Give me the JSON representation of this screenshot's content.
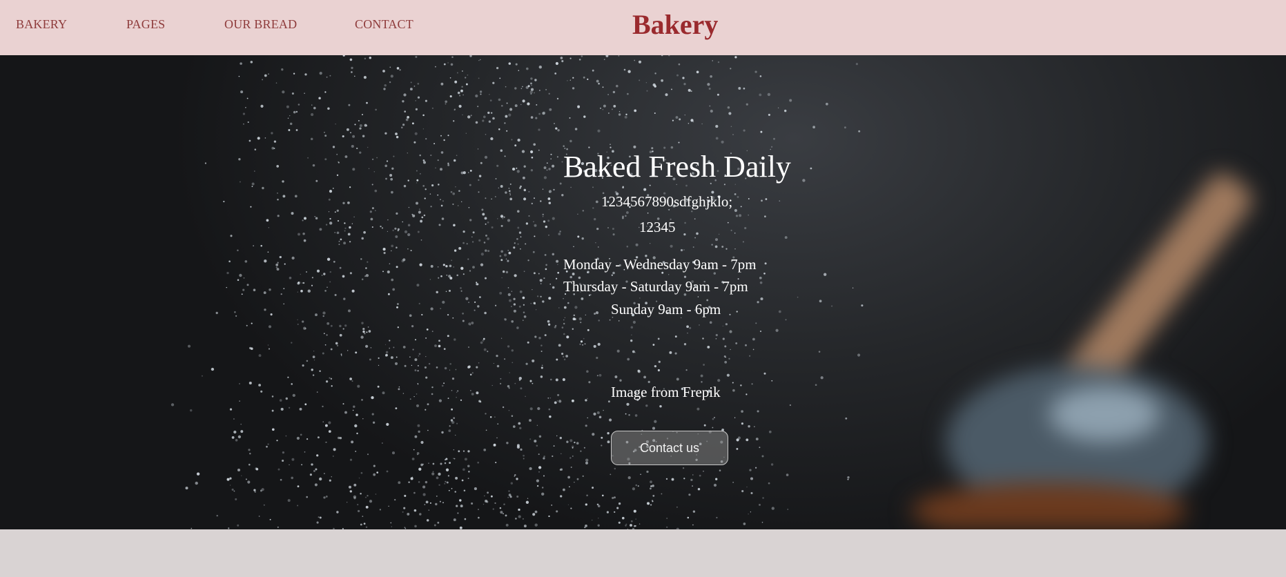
{
  "nav": {
    "items": [
      {
        "label": "BAKERY"
      },
      {
        "label": "PAGES"
      },
      {
        "label": "OUR BREAD"
      },
      {
        "label": "CONTACT"
      }
    ],
    "brand": "Bakery"
  },
  "hero": {
    "title": "Baked Fresh Daily",
    "line1": "1234567890sdfghjklo;",
    "line2": "12345",
    "hours": [
      "Monday - Wednesday 9am - 7pm",
      "Thursday - Saturday 9am - 7pm",
      "Sunday 9am - 6pm"
    ],
    "credit": "Image from Frepik",
    "contact_button": "Contact us"
  },
  "colors": {
    "nav_background": "#ead2d2",
    "nav_text": "#8e3b3b",
    "brand": "#9a2a2e",
    "page_background": "#d9d3d3"
  }
}
